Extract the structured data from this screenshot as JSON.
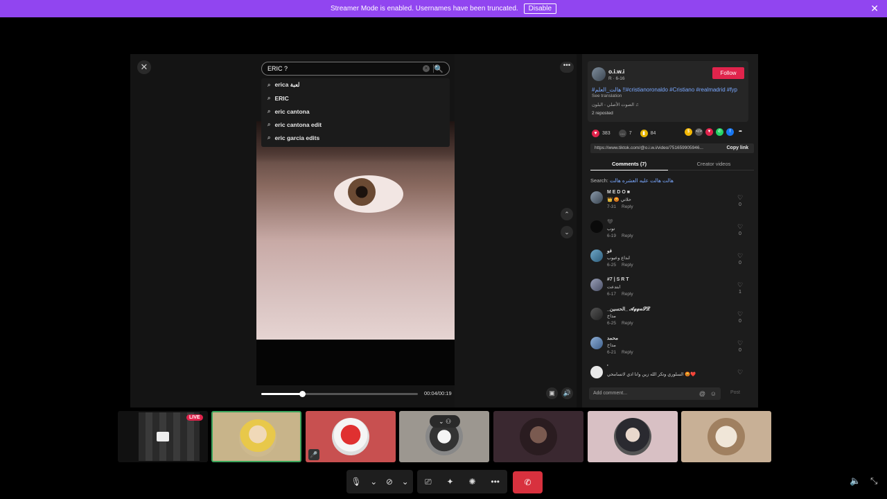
{
  "banner": {
    "message": "Streamer Mode is enabled. Usernames have been truncated.",
    "disable_label": "Disable",
    "close_glyph": "✕"
  },
  "viewer": {
    "close_glyph": "✕",
    "search": {
      "value": "ERIC ?",
      "clear_glyph": "×",
      "search_icon": "🔍"
    },
    "suggestions": [
      "erica لعبة",
      "ERIC",
      "eric cantona",
      "eric cantona edit",
      "eric garcia edits"
    ],
    "progress": {
      "fraction": 0.26,
      "time": "00:04/00:19"
    },
    "more_glyph": "•••",
    "nav_up_glyph": "⌃",
    "nav_down_glyph": "⌄"
  },
  "post": {
    "username": "o.i.w.i",
    "sub": "R · 6-16",
    "follow_label": "Follow",
    "description": "#هالت_العلم !!#cristianoronaldo #Cristiano #realmadrid #fyp",
    "see_translation": "See translation",
    "sound": "الصوت الأصلي - البلون ♫",
    "reposted": "2 reposted",
    "likes": "383",
    "comments": "7",
    "saves": "84",
    "link": "https://www.tiktok.com/@o.i.w.i/video/751659905946...",
    "copy_label": "Copy link",
    "tab_comments": "Comments (7)",
    "tab_creator": "Creator videos",
    "search_label": "Search:",
    "search_query": "هالت هالت عليه العشره هالت",
    "add_comment_placeholder": "Add comment...",
    "post_label": "Post"
  },
  "comments": [
    {
      "name": "M E D O ■",
      "text": "👑 😡 حلاتي",
      "date": "7-31",
      "reply": "Reply",
      "likes": "0"
    },
    {
      "name": "🖤",
      "text": "توب",
      "date": "6-19",
      "reply": "Reply",
      "likes": "0"
    },
    {
      "name": "فو",
      "text": "ابداع وعيوب",
      "date": "6-25",
      "reply": "Reply",
      "likes": "0"
    },
    {
      "name": "#7 | S R T",
      "text": "ابتدعت",
      "date": "6-17",
      "reply": "Reply",
      "likes": "1"
    },
    {
      "name": "_الحسين_ 𝓐𝓰𝓰𝓪𝓢𝓛 ",
      "text": "مداخ",
      "date": "6-25",
      "reply": "Reply",
      "likes": "0"
    },
    {
      "name": "محمد",
      "text": "مداخ",
      "date": "6-21",
      "reply": "Reply",
      "likes": "0"
    },
    {
      "name": "'",
      "text": "السلوري وتكر الله زين وانا ادي لاتسامحي 😡❤️",
      "date": "",
      "reply": "",
      "likes": ""
    }
  ],
  "tiles": {
    "live_label": "LIVE"
  },
  "colors": {
    "banner": "#9145f0",
    "follow": "#e0244c",
    "end_call": "#d8313e",
    "link": "#7aa8ff"
  }
}
